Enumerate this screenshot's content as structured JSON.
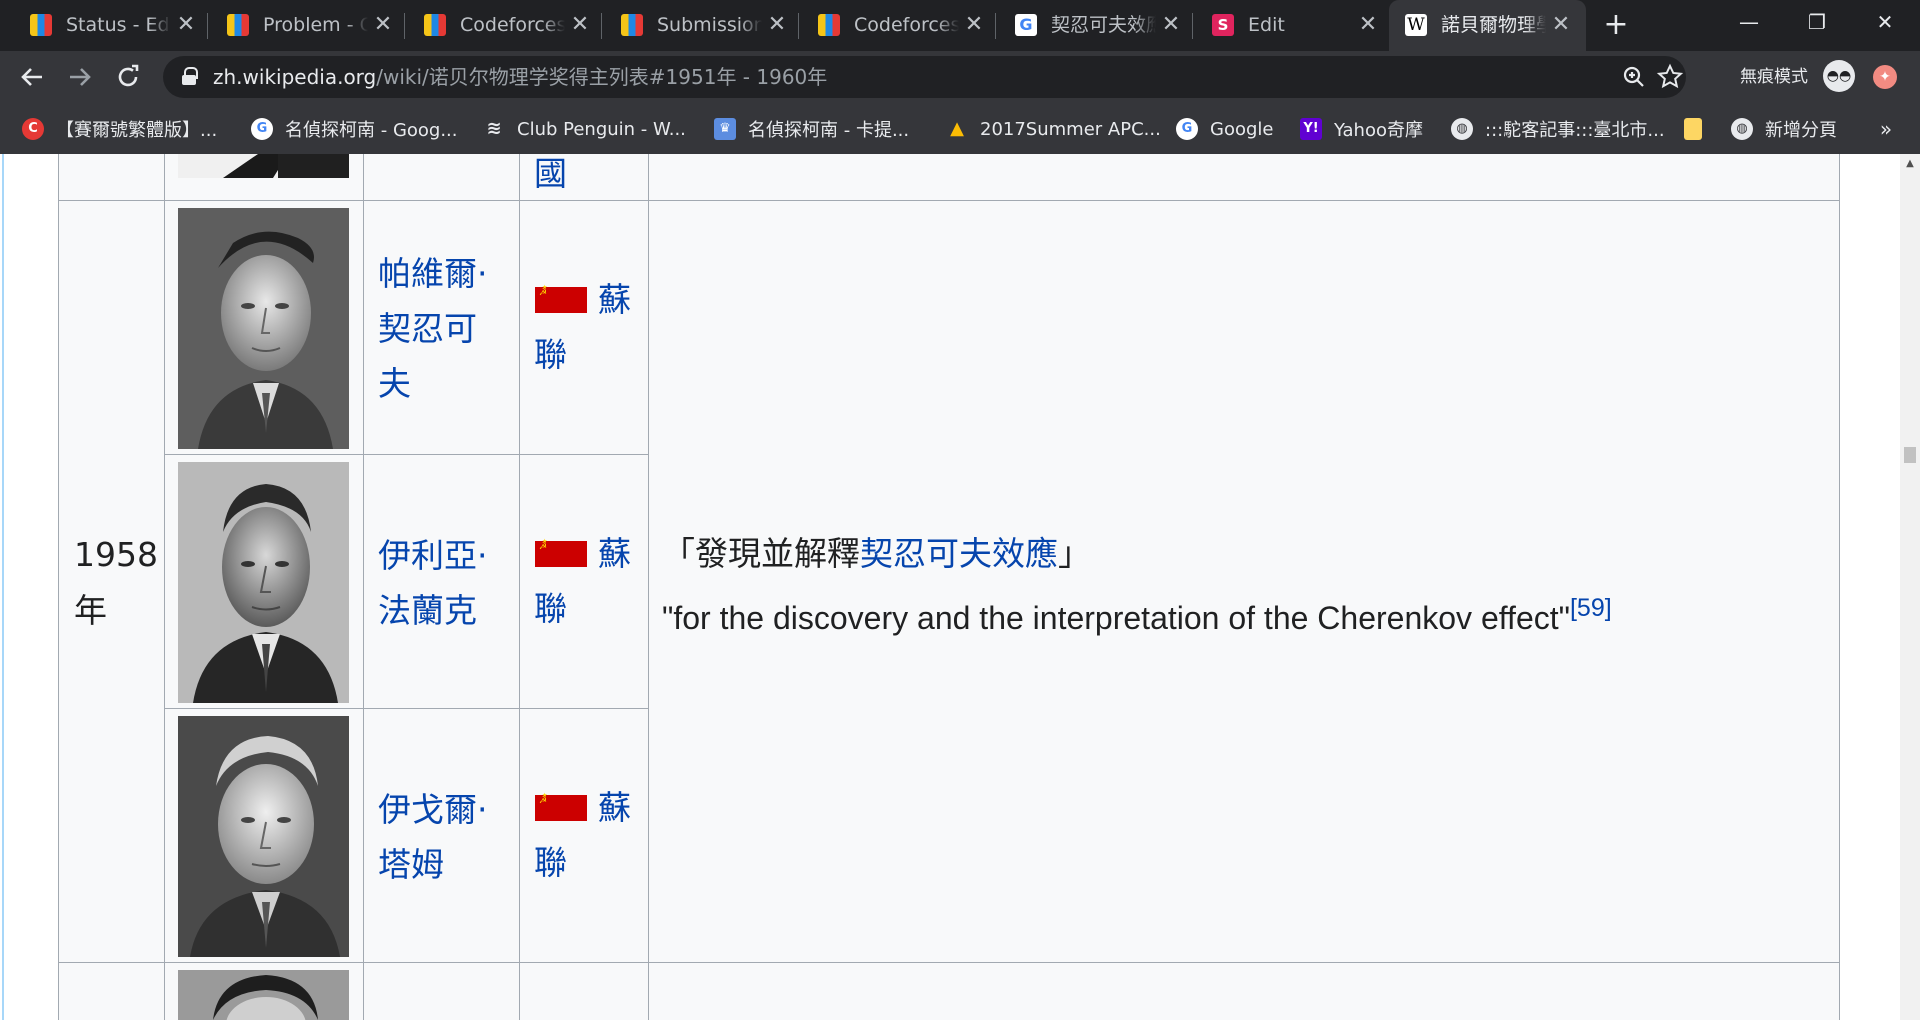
{
  "browser": {
    "tabs": [
      {
        "title": "Status - Educational Codeforces",
        "favicon": "codeforces-icon"
      },
      {
        "title": "Problem - G - Codeforces",
        "favicon": "codeforces-icon"
      },
      {
        "title": "Codeforces",
        "favicon": "codeforces-icon"
      },
      {
        "title": "Submission",
        "favicon": "codeforces-icon"
      },
      {
        "title": "Codeforces",
        "favicon": "codeforces-icon"
      },
      {
        "title": "契忍可夫效應",
        "favicon": "google-icon"
      },
      {
        "title": "Edit",
        "favicon": "s-icon"
      },
      {
        "title": "諾貝爾物理學獎",
        "favicon": "wikipedia-icon",
        "active": true
      }
    ],
    "tab_close_glyph": "✕",
    "new_tab_glyph": "+",
    "window_controls": {
      "minimize": "—",
      "restore": "❐",
      "close": "✕"
    },
    "url": {
      "host": "zh.wikipedia.org",
      "path": "/wiki/诺贝尔物理学奖得主列表#1951年 - 1960年"
    },
    "incognito_label": "無痕模式",
    "bookmarks": [
      {
        "label": "【賽爾號繁體版】...",
        "icon": "cc-icon",
        "glyph": "C"
      },
      {
        "label": "名偵探柯南 - Goog...",
        "icon": "google-icon",
        "glyph": "G"
      },
      {
        "label": "Club Penguin - W...",
        "icon": "penguin-icon",
        "glyph": "≋"
      },
      {
        "label": "名偵探柯南 - 卡提...",
        "icon": "crown-icon",
        "glyph": "♛"
      },
      {
        "label": "2017Summer APC...",
        "icon": "drive-icon",
        "glyph": "▲"
      },
      {
        "label": "Google",
        "icon": "google-icon",
        "glyph": "G"
      },
      {
        "label": "Yahoo奇摩",
        "icon": "yahoo-icon",
        "glyph": "Y!"
      },
      {
        "label": ":::駝客記事:::臺北市...",
        "icon": "globe-icon",
        "glyph": "◍"
      },
      {
        "label": "",
        "icon": "folder-icon",
        "glyph": ""
      },
      {
        "label": "新增分頁",
        "icon": "globe-icon",
        "glyph": "◍"
      }
    ],
    "bookmarks_more_glyph": "»"
  },
  "table": {
    "top_partial_country": "國",
    "year": {
      "line1": "1958",
      "line2": "年"
    },
    "laureates": [
      {
        "name_lines": [
          "帕維爾·",
          "契忍可",
          "夫"
        ],
        "country_lines": [
          "蘇",
          "聯"
        ],
        "flag": "soviet-flag"
      },
      {
        "name_lines": [
          "伊利亞·",
          "法蘭克"
        ],
        "country_lines": [
          "蘇",
          "聯"
        ],
        "flag": "soviet-flag"
      },
      {
        "name_lines": [
          "伊戈爾·",
          "塔姆"
        ],
        "country_lines": [
          "蘇",
          "聯"
        ],
        "flag": "soviet-flag"
      }
    ],
    "citation": {
      "zh_open": "「發現並解釋",
      "zh_link": "契忍可夫效應",
      "zh_close": "」",
      "en": "\"for the discovery and the interpretation of the Cherenkov effect\"",
      "ref": "[59]"
    }
  },
  "colors": {
    "link": "#0645ad",
    "text": "#202122",
    "border": "#a2a9b1",
    "cell_bg": "#f8f9fa",
    "tab_strip": "#202124",
    "toolbar": "#35363a"
  }
}
